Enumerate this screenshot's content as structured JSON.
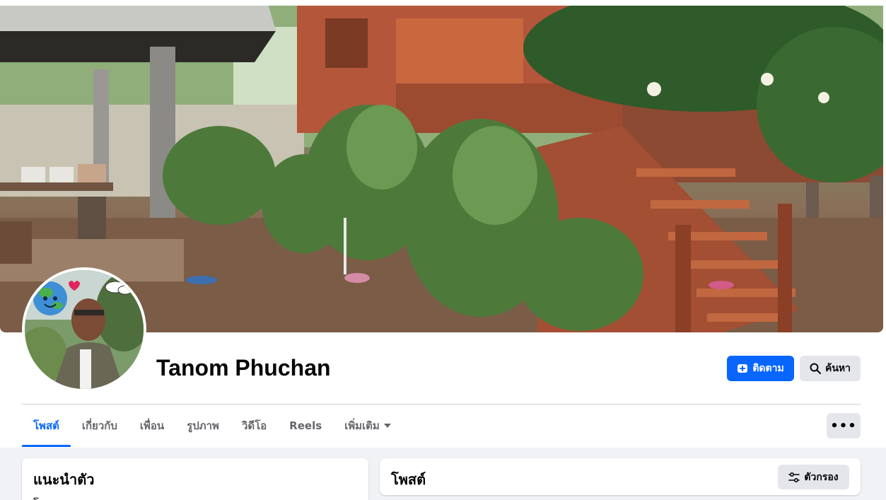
{
  "profile": {
    "name": "Tanom Phuchan"
  },
  "actions": {
    "follow_label": "ติดตาม",
    "search_label": "ค้นหา",
    "more_label": "•••"
  },
  "tabs": [
    {
      "label": "โพสต์",
      "active": true
    },
    {
      "label": "เกี่ยวกับ",
      "active": false
    },
    {
      "label": "เพื่อน",
      "active": false
    },
    {
      "label": "รูปภาพ",
      "active": false
    },
    {
      "label": "วิดีโอ",
      "active": false
    },
    {
      "label": "Reels",
      "active": false
    },
    {
      "label": "เพิ่มเติม",
      "active": false
    }
  ],
  "intro": {
    "title": "แนะนำตัว",
    "first_line": "โ"
  },
  "posts": {
    "title": "โพสต์",
    "filter_label": "ตัวกรอง"
  },
  "icons": {
    "follow": "add-friend-icon",
    "search": "magnifier-icon",
    "more_tab": "caret-down-icon",
    "filter": "sliders-icon"
  },
  "colors": {
    "accent": "#0866ff",
    "secondary_button": "#e4e6eb",
    "page_bg": "#f0f2f5"
  }
}
